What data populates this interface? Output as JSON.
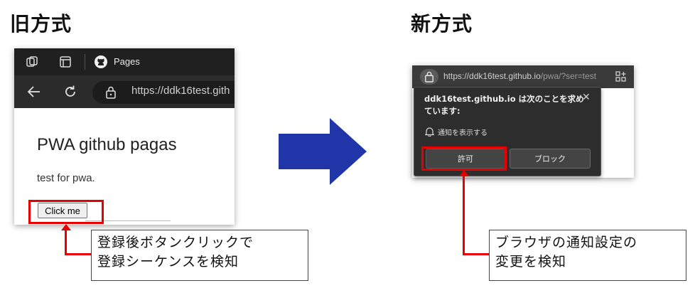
{
  "left": {
    "heading": "旧方式",
    "browser": {
      "tab_title": "Pages",
      "url": "https://ddk16test.gith",
      "page_title": "PWA github pagas",
      "page_text": "test for pwa.",
      "button_label": "Click me"
    },
    "callout": {
      "line1": "登録後ボタンクリックで",
      "line2": "登録シーケンスを検知"
    }
  },
  "right": {
    "heading": "新方式",
    "browser": {
      "url_host": "https://ddk16test.github.io",
      "url_path": "/pwa/?ser=test"
    },
    "popup": {
      "title": "ddk16test.github.io は次のことを求めています:",
      "notify_text": "通知を表示する",
      "allow_label": "許可",
      "block_label": "ブロック",
      "close_glyph": "✕"
    },
    "callout": {
      "line1": "ブラウザの通知設定の",
      "line2": "変更を検知"
    }
  },
  "colors": {
    "highlight_red": "#e60000",
    "arrow_blue": "#1f35a8",
    "dark_chrome": "#202020"
  }
}
